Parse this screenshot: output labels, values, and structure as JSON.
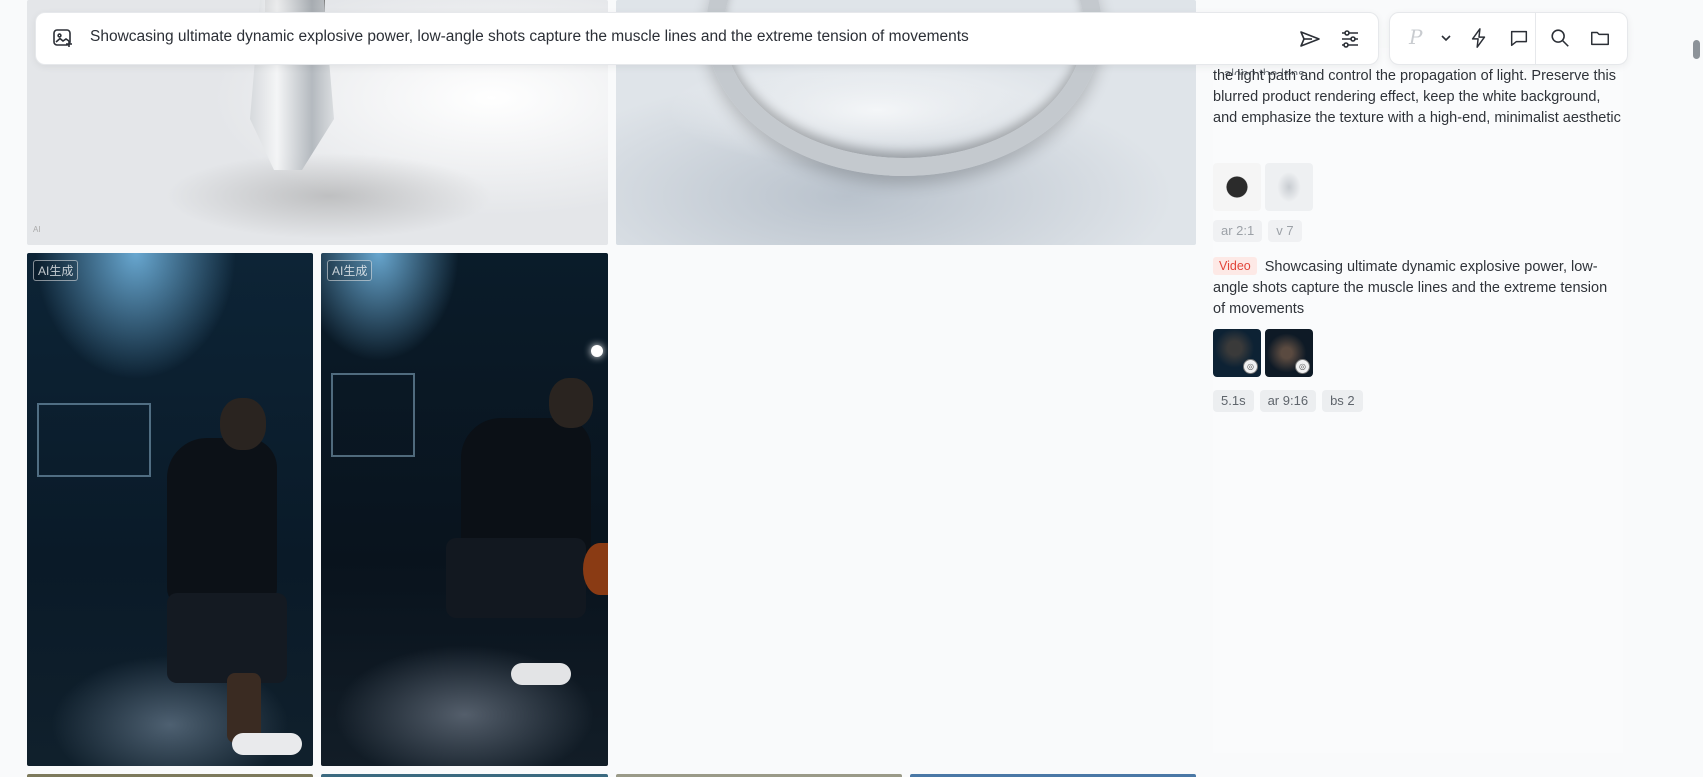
{
  "search": {
    "query": "Showcasing ultimate dynamic explosive power, low-angle shots capture the muscle lines and the extreme tension of movements"
  },
  "controls": {
    "model_letter": "P"
  },
  "gallery": {
    "ai_badge": "AI生成",
    "pen_watermark": "AI生成\n@@@@@"
  },
  "history": [
    {
      "prompt_clipped": "...along the lens, ...",
      "prompt": "the light path and control the propagation of light. Preserve this blurred product rendering effect, keep the white background, and emphasize the texture with a high-end, minimalist aesthetic",
      "tags": [
        "ar 2:1",
        "v 7"
      ]
    },
    {
      "badge": "Video",
      "prompt": "Showcasing ultimate dynamic explosive power, low-angle shots capture the muscle lines and the extreme tension of movements",
      "tags": [
        "5.1s",
        "ar 9:16",
        "bs 2"
      ]
    }
  ]
}
